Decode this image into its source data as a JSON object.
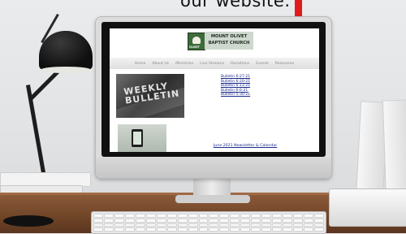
{
  "caption": "our website.",
  "colors": {
    "arrow": "#e01b1b",
    "link": "#1a2a8a",
    "logo_green": "#3e6b3a"
  },
  "site": {
    "logo_text": "OLIVET",
    "church_name_line1": "MOUNT OLIVET",
    "church_name_line2": "BAPTIST CHURCH",
    "nav": [
      "Home",
      "About Us",
      "Ministries",
      "Live Streams",
      "Donations",
      "Events",
      "Resources"
    ],
    "banner_line1": "WEEKLY",
    "banner_line2": "BULLETIN",
    "bulletins": [
      "Bulletin 6-27-21",
      "Bulletin 6-20-21",
      "Bulletin 6-13-21",
      "Bulletin 6-6-21",
      "Bulletin 5-30-21"
    ],
    "newsletter_link": "June 2021 Newsletter & Calendar"
  },
  "icons": [
    "desk-lamp-icon",
    "monitor-icon",
    "keyboard-icon",
    "red-down-arrow-icon"
  ]
}
